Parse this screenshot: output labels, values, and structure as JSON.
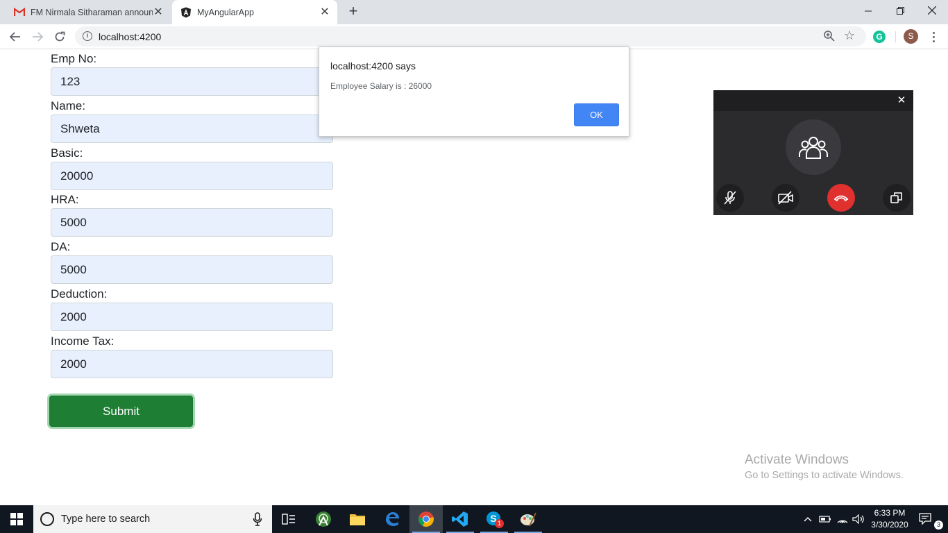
{
  "browser": {
    "tabs": [
      {
        "title": "FM Nirmala Sitharaman announc",
        "icon": "gmail-icon",
        "active": false
      },
      {
        "title": "MyAngularApp",
        "icon": "angular-icon",
        "active": true
      }
    ],
    "new_tab_label": "+",
    "close_glyph": "✕",
    "url": "localhost:4200",
    "profile_initial": "S",
    "extension_initial": "G",
    "window_controls": {
      "minimize": "—",
      "maximize": "❐",
      "close": "✕"
    }
  },
  "form": {
    "fields": [
      {
        "label": "Emp No:",
        "value": "123"
      },
      {
        "label": "Name:",
        "value": "Shweta"
      },
      {
        "label": "Basic:",
        "value": "20000"
      },
      {
        "label": "HRA:",
        "value": "5000"
      },
      {
        "label": "DA:",
        "value": "5000"
      },
      {
        "label": "Deduction:",
        "value": "2000"
      },
      {
        "label": "Income Tax:",
        "value": "2000"
      }
    ],
    "submit_label": "Submit"
  },
  "dialog": {
    "title": "localhost:4200 says",
    "message": "Employee Salary is : 26000",
    "ok_label": "OK"
  },
  "call_window": {
    "close_glyph": "✕",
    "buttons": [
      "mic-off-icon",
      "video-off-icon",
      "hang-up-icon",
      "popout-icon"
    ]
  },
  "watermark": {
    "title": "Activate Windows",
    "subtitle": "Go to Settings to activate Windows."
  },
  "taskbar": {
    "search_placeholder": "Type here to search",
    "apps": [
      "task-view-icon",
      "android-studio-icon",
      "file-explorer-icon",
      "edge-icon",
      "chrome-icon",
      "vscode-icon",
      "skype-icon",
      "paint-icon"
    ],
    "skype_badge": "1",
    "time": "6:33 PM",
    "date": "3/30/2020",
    "notification_count": "3",
    "tray_chevron": "^"
  }
}
